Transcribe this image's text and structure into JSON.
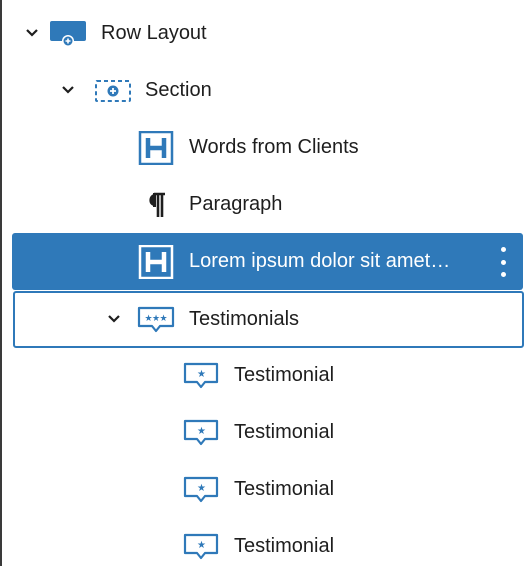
{
  "colors": {
    "accent": "#2f79b9",
    "icon": "#2f79b9",
    "text": "#1e1e1e",
    "selected_text": "#ffffff"
  },
  "tree": [
    {
      "label": "Row Layout",
      "icon": "row-layout-icon",
      "expanded": true
    },
    {
      "label": "Section",
      "icon": "section-icon",
      "expanded": true
    },
    {
      "label": "Words from Clients",
      "icon": "heading-icon"
    },
    {
      "label": "Paragraph",
      "icon": "paragraph-icon"
    },
    {
      "label": "Lorem ipsum dolor sit amet…",
      "icon": "heading-icon",
      "selected": true,
      "options_icon": "more-vertical-icon"
    },
    {
      "label": "Testimonials",
      "icon": "testimonials-icon",
      "expanded": true,
      "focused": true
    },
    {
      "label": "Testimonial",
      "icon": "testimonial-icon"
    },
    {
      "label": "Testimonial",
      "icon": "testimonial-icon"
    },
    {
      "label": "Testimonial",
      "icon": "testimonial-icon"
    },
    {
      "label": "Testimonial",
      "icon": "testimonial-icon"
    }
  ]
}
